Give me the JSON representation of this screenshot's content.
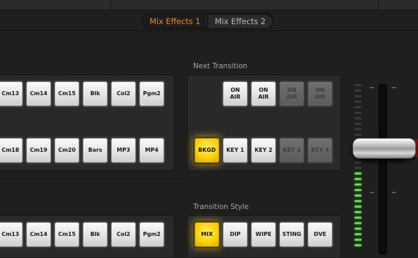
{
  "tabs": [
    {
      "label": "Mix Effects 1",
      "active": true
    },
    {
      "label": "Mix Effects 2",
      "active": false
    }
  ],
  "next_transition": {
    "title": "Next Transition",
    "on_air_buttons": [
      {
        "label": "ON AIR",
        "state": "normal"
      },
      {
        "label": "ON AIR",
        "state": "normal"
      },
      {
        "label": "ON AIR",
        "state": "dim"
      },
      {
        "label": "ON AIR",
        "state": "dim"
      }
    ],
    "layer_buttons": [
      {
        "label": "BKGD",
        "state": "lit"
      },
      {
        "label": "KEY 1",
        "state": "normal"
      },
      {
        "label": "KEY 2",
        "state": "normal"
      },
      {
        "label": "KEY 3",
        "state": "dim"
      },
      {
        "label": "KEY 4",
        "state": "dim"
      }
    ]
  },
  "transition_style": {
    "title": "Transition Style",
    "buttons": [
      {
        "label": "MIX",
        "state": "lit"
      },
      {
        "label": "DIP",
        "state": "normal"
      },
      {
        "label": "WIPE",
        "state": "normal"
      },
      {
        "label": "STING",
        "state": "normal"
      },
      {
        "label": "DVE",
        "state": "normal"
      }
    ]
  },
  "program_row": [
    "Cm13",
    "Cm14",
    "Cm15",
    "Blk",
    "Col2",
    "Pgm2"
  ],
  "preview_row": [
    "Cm18",
    "Cm19",
    "Cm20",
    "Bars",
    "MP3",
    "MP4"
  ],
  "bottom_row": [
    "Cm13",
    "Cm14",
    "Cm15",
    "Blk",
    "Col2",
    "Pgm2"
  ],
  "tbar": {
    "lit_segments": 14,
    "total_segments": 30
  },
  "colors": {
    "accent": "#f0892d",
    "lit": "#ffd400",
    "meter": "#5fe04a"
  }
}
